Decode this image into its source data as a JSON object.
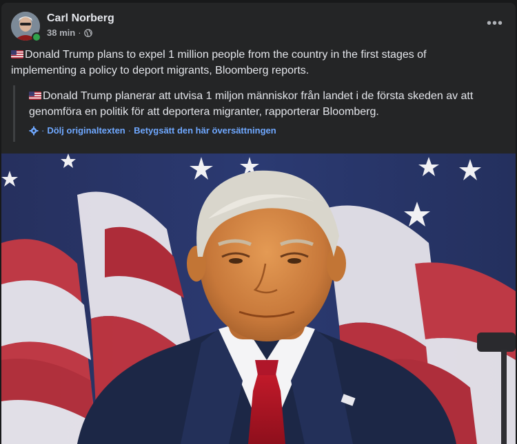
{
  "post": {
    "author": "Carl Norberg",
    "time": "38 min",
    "dot": "·",
    "audience_icon": "globe-icon",
    "more_icon": "more-options-icon",
    "more_label": "•••",
    "text": "Donald Trump plans to expel 1 million people from the country in the first stages of implementing a policy to deport migrants, Bloomberg reports.",
    "original_text": "Donald Trump planerar att utvisa 1 miljon människor från landet i de första skeden av att genomföra en politik för att deportera migranter, rapporterar Bloomberg.",
    "flag_icon": "us-flag-icon",
    "hide_original_label": "Dölj originaltexten",
    "rate_translation_label": "Betygsätt den här översättningen",
    "link_sep": "·",
    "online": true
  },
  "colors": {
    "background": "#18191a",
    "card": "#242526",
    "text_primary": "#e4e6eb",
    "text_secondary": "#b0b3b8",
    "link": "#6fa8ff",
    "online": "#31a24c"
  }
}
